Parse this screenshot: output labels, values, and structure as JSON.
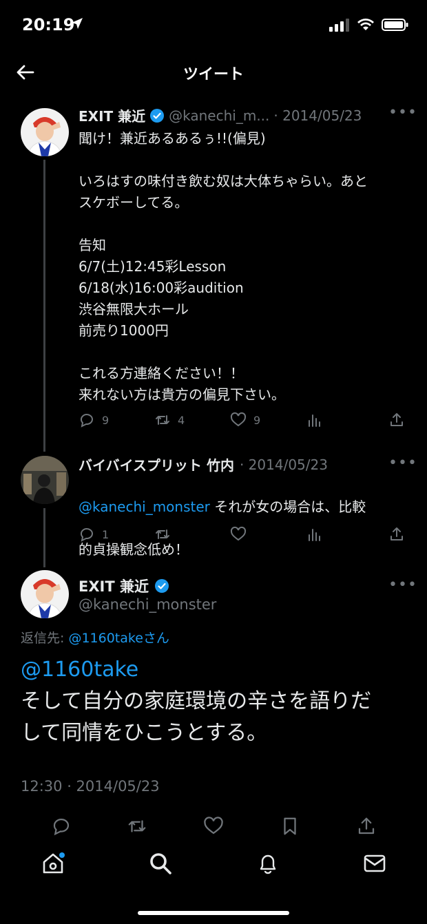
{
  "status_bar": {
    "time": "20:19"
  },
  "header": {
    "title": "ツイート"
  },
  "tweet1": {
    "name": "EXIT 兼近",
    "handle": "@kanechi_m...",
    "date": "· 2014/05/23",
    "text": "聞け！兼近あるあるぅ!!(偏見)\n\nいろはすの味付き飲む奴は大体ちゃらい。あと\nスケボーしてる。\n\n告知\n6/7(土)12:45彩Lesson\n6/18(水)16:00彩audition\n渋谷無限大ホール\n前売り1000円\n\nこれる方連絡ください！！\n来れない方は貴方の偏見下さい。",
    "replies": "9",
    "retweets": "4",
    "likes": "9"
  },
  "tweet2": {
    "name": "バイバイスプリット 竹内",
    "date": "· 2014/05/23",
    "mention": "@kanechi_monster",
    "text_after_mention": " それが女の場合は、比較",
    "text_line2": "的貞操観念低め！",
    "replies": "1",
    "retweets": "",
    "likes": ""
  },
  "main_tweet": {
    "name": "EXIT 兼近",
    "handle": "@kanechi_monster",
    "reply_to_label": "返信先: ",
    "reply_to_user": "@1160take",
    "reply_to_suffix": "さん",
    "mention": "@1160take",
    "text_line1": "そして自分の家庭環境の辛さを語りだ",
    "text_line2": "して同情をひこうとする。",
    "timestamp": "12:30 · 2014/05/23"
  },
  "colors": {
    "link": "#1d9bf0",
    "muted": "#71767b",
    "verified": "#1d9bf0"
  },
  "icons": [
    "back-arrow-icon",
    "reply-icon",
    "retweet-icon",
    "like-icon",
    "views-icon",
    "share-icon",
    "bookmark-icon",
    "home-icon",
    "search-icon",
    "bell-icon",
    "mail-icon",
    "more-icon",
    "verified-icon"
  ]
}
